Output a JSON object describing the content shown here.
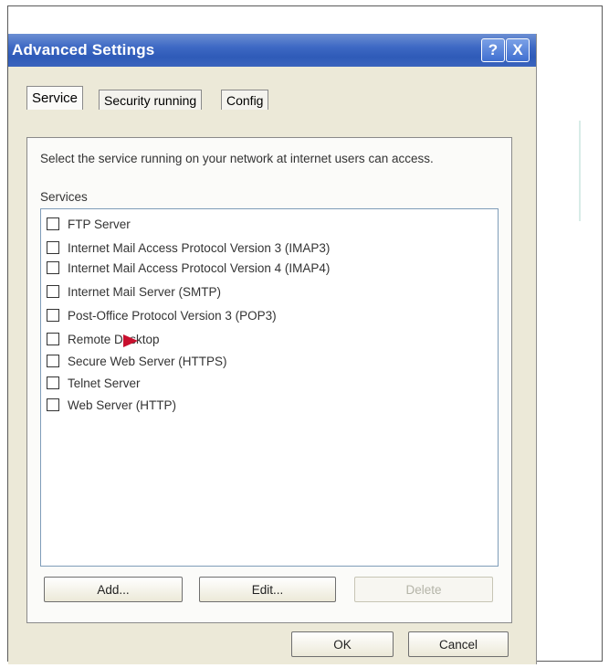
{
  "window": {
    "title": "Advanced Settings",
    "help_label": "?",
    "close_label": "X"
  },
  "tabs": [
    {
      "label": "Service",
      "active": true
    },
    {
      "label": "Security running",
      "active": false
    },
    {
      "label": "Config",
      "active": false
    }
  ],
  "service_tab": {
    "description": "Select the service running on your network at internet users can access.",
    "services_label": "Services",
    "services": [
      {
        "label": "FTP Server",
        "checked": false
      },
      {
        "label": "Internet Mail Access Protocol Version 3 (IMAP3)",
        "checked": false
      },
      {
        "label": "Internet Mail Access Protocol Version 4 (IMAP4)",
        "checked": false
      },
      {
        "label": "Internet Mail Server (SMTP)",
        "checked": false
      },
      {
        "label": "Post-Office Protocol Version 3 (POP3)",
        "checked": false
      },
      {
        "label": "Remote Desktop",
        "checked": false
      },
      {
        "label": "Secure Web Server (HTTPS)",
        "checked": false
      },
      {
        "label": "Telnet Server",
        "checked": false
      },
      {
        "label": "Web Server (HTTP)",
        "checked": false
      }
    ],
    "add_label": "Add...",
    "edit_label": "Edit...",
    "delete_label": "Delete"
  },
  "footer": {
    "ok_label": "OK",
    "cancel_label": "Cancel"
  },
  "colors": {
    "titlebar": "#2f5bb8",
    "dialog_bg": "#ece9d8",
    "flag": "#c8102e"
  }
}
